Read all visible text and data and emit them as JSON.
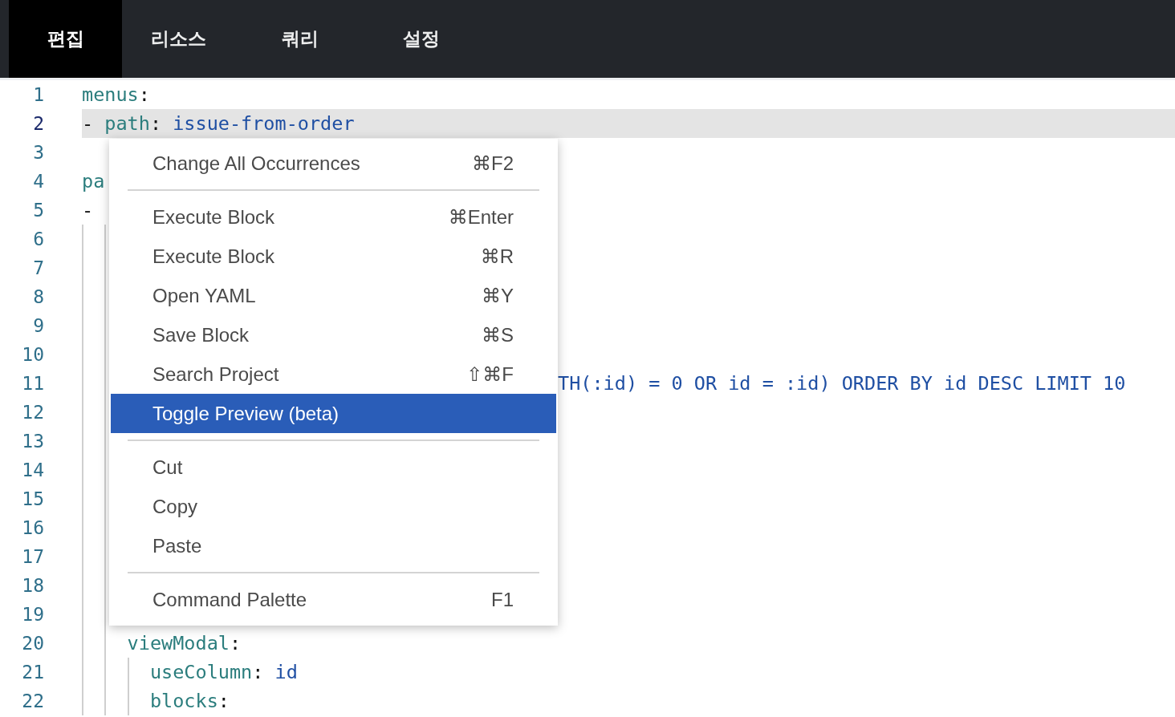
{
  "tabs": [
    {
      "label": "편집",
      "selected": true
    },
    {
      "label": "리소스",
      "selected": false
    },
    {
      "label": "쿼리",
      "selected": false
    },
    {
      "label": "설정",
      "selected": false
    }
  ],
  "editor": {
    "lines": [
      {
        "number": "1",
        "current": false,
        "tokens": [
          {
            "kind": "key",
            "text": "menus"
          },
          {
            "kind": "punct",
            "text": ":"
          }
        ]
      },
      {
        "number": "2",
        "current": true,
        "tokens": [
          {
            "kind": "punct",
            "text": "- "
          },
          {
            "kind": "key",
            "text": "path"
          },
          {
            "kind": "punct",
            "text": ": "
          },
          {
            "kind": "value",
            "text": "issue-from-order"
          }
        ]
      },
      {
        "number": "3",
        "current": false
      },
      {
        "number": "4",
        "current": false,
        "tokens": [
          {
            "kind": "key",
            "text": "pa"
          }
        ]
      },
      {
        "number": "5",
        "current": false,
        "tokens": [
          {
            "kind": "punct",
            "text": "-"
          }
        ]
      },
      {
        "number": "6",
        "current": false
      },
      {
        "number": "7",
        "current": false
      },
      {
        "number": "8",
        "current": false
      },
      {
        "number": "9",
        "current": false
      },
      {
        "number": "10",
        "current": false
      },
      {
        "number": "11",
        "current": false,
        "tail": "TH(:id) = 0 OR id = :id) ORDER BY id DESC LIMIT 10"
      },
      {
        "number": "12",
        "current": false
      },
      {
        "number": "13",
        "current": false
      },
      {
        "number": "14",
        "current": false
      },
      {
        "number": "15",
        "current": false
      },
      {
        "number": "16",
        "current": false
      },
      {
        "number": "17",
        "current": false
      },
      {
        "number": "18",
        "current": false
      },
      {
        "number": "19",
        "current": false
      },
      {
        "number": "20",
        "current": false,
        "tokens": [
          {
            "kind": "key",
            "text": "    viewModal"
          },
          {
            "kind": "punct",
            "text": ":"
          }
        ]
      },
      {
        "number": "21",
        "current": false,
        "tokens": [
          {
            "kind": "key",
            "text": "      useColumn"
          },
          {
            "kind": "punct",
            "text": ": "
          },
          {
            "kind": "value",
            "text": "id"
          }
        ]
      },
      {
        "number": "22",
        "current": false,
        "tokens": [
          {
            "kind": "key",
            "text": "      blocks"
          },
          {
            "kind": "punct",
            "text": ":"
          }
        ]
      }
    ]
  },
  "context_menu": {
    "items": [
      {
        "kind": "item",
        "label": "Change All Occurrences",
        "shortcut": "⌘F2",
        "selected": false
      },
      {
        "kind": "separator"
      },
      {
        "kind": "item",
        "label": "Execute Block",
        "shortcut": "⌘Enter",
        "selected": false
      },
      {
        "kind": "item",
        "label": "Execute Block",
        "shortcut": "⌘R",
        "selected": false
      },
      {
        "kind": "item",
        "label": "Open YAML",
        "shortcut": "⌘Y",
        "selected": false
      },
      {
        "kind": "item",
        "label": "Save Block",
        "shortcut": "⌘S",
        "selected": false
      },
      {
        "kind": "item",
        "label": "Search Project",
        "shortcut": "⇧⌘F",
        "selected": false
      },
      {
        "kind": "item",
        "label": "Toggle Preview (beta)",
        "selected": true
      },
      {
        "kind": "separator"
      },
      {
        "kind": "item",
        "label": "Cut",
        "selected": false
      },
      {
        "kind": "item",
        "label": "Copy",
        "selected": false
      },
      {
        "kind": "item",
        "label": "Paste",
        "selected": false
      },
      {
        "kind": "separator"
      },
      {
        "kind": "item",
        "label": "Command Palette",
        "shortcut": "F1",
        "selected": false
      }
    ]
  }
}
